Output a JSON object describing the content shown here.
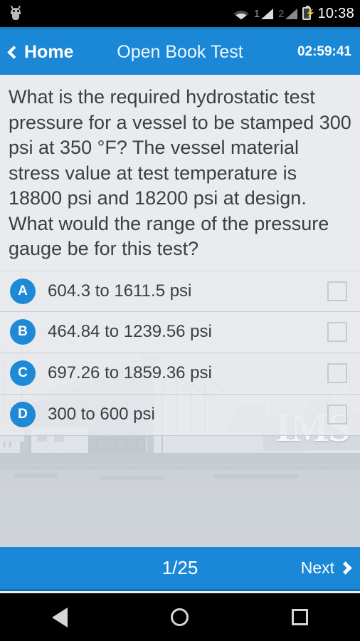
{
  "status_bar": {
    "app_icon": "android-bug-icon",
    "wifi_icon": "wifi-icon",
    "sim1_label": "1",
    "sim2_label": "2",
    "battery_icon": "battery-charging-icon",
    "time": "10:38"
  },
  "app_bar": {
    "back_icon": "chevron-left-icon",
    "back_label": "Home",
    "title": "Open Book Test",
    "timer": "02:59:41"
  },
  "question": {
    "text": "What is the required hydrostatic test pressure for a vessel to be stamped 300 psi at 350 °F? The vessel material stress value at test temperature is 18800 psi and 18200 psi at design. What would the range of the pressure gauge be for this test?"
  },
  "options": [
    {
      "letter": "A",
      "text": "604.3 to 1611.5 psi",
      "checked": false
    },
    {
      "letter": "B",
      "text": "464.84 to 1239.56 psi",
      "checked": false
    },
    {
      "letter": "C",
      "text": "697.26 to 1859.36 psi",
      "checked": false
    },
    {
      "letter": "D",
      "text": "300 to 600 psi",
      "checked": false
    }
  ],
  "background": {
    "watermark": "IMS"
  },
  "bottom_bar": {
    "page_indicator": "1/25",
    "next_label": "Next",
    "next_icon": "chevron-right-icon"
  },
  "nav_bar": {
    "back_icon": "triangle-back-icon",
    "home_icon": "circle-home-icon",
    "recents_icon": "square-recents-icon"
  },
  "colors": {
    "accent_blue": "#1a87d7",
    "badge_blue": "#1e8ad6",
    "content_bg": "#e9ebee",
    "text": "#3c3f42"
  }
}
